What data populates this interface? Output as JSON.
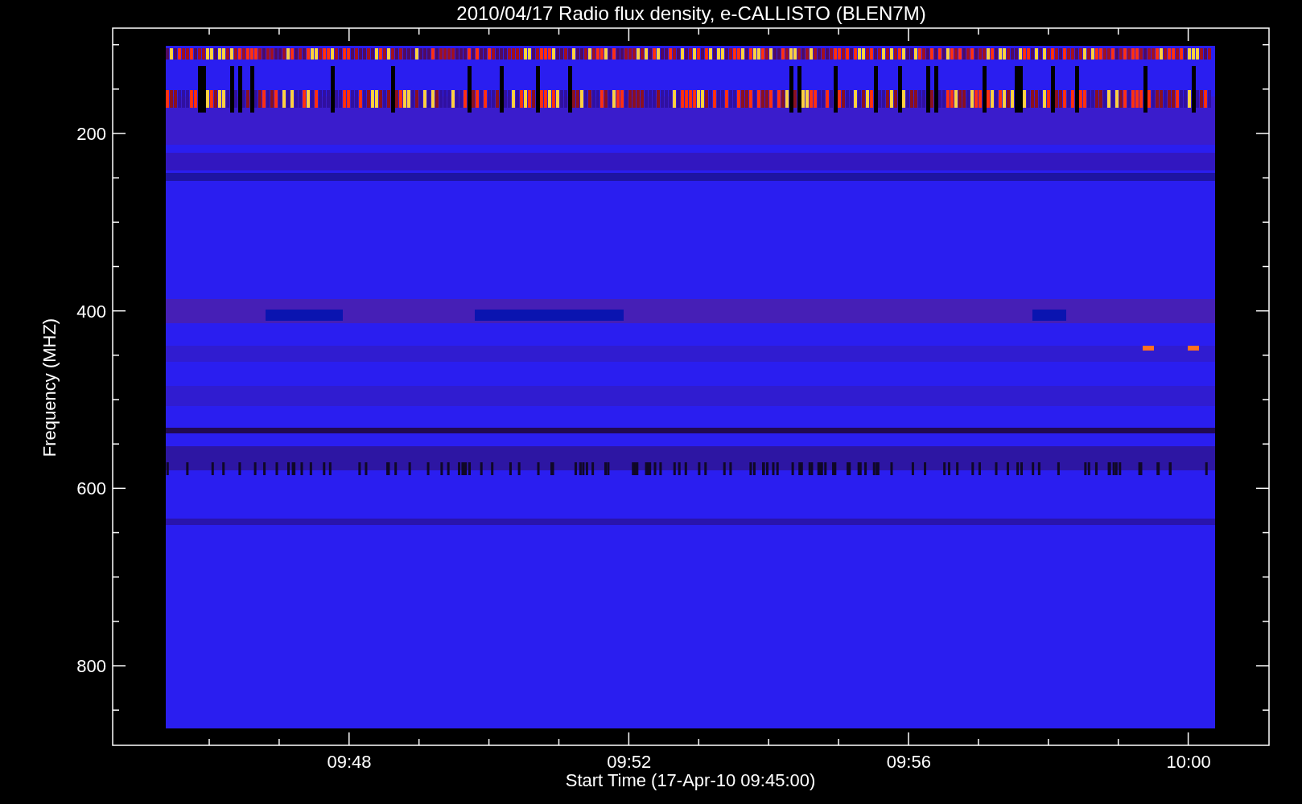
{
  "chart": {
    "title": "2010/04/17  Radio flux density, e-CALLISTO (BLEN7M)",
    "ylabel": "Frequency (MHZ)",
    "yticks": [
      "200",
      "400",
      "600",
      "800"
    ],
    "xticks": [
      "09:48",
      "09:52",
      "09:56",
      "10:00"
    ],
    "xlabel": "Start Time (17-Apr-10 09:45:00)"
  }
}
